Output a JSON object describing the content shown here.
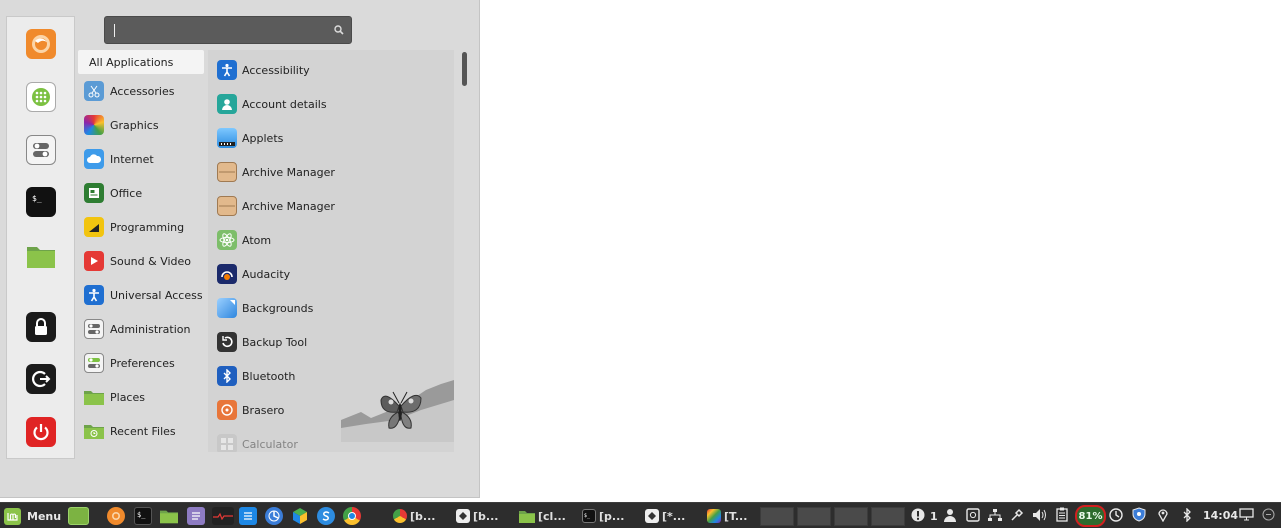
{
  "search": {
    "value": "",
    "placeholder": ""
  },
  "favorites": [
    {
      "name": "firefox-icon"
    },
    {
      "name": "software-manager-icon"
    },
    {
      "name": "settings-toggles-icon"
    },
    {
      "name": "terminal-icon"
    },
    {
      "name": "files-folder-icon"
    },
    {
      "name": "lock-screen-icon"
    },
    {
      "name": "logout-icon"
    },
    {
      "name": "power-icon"
    }
  ],
  "categories": [
    {
      "label": "All Applications"
    },
    {
      "label": "Accessories"
    },
    {
      "label": "Graphics"
    },
    {
      "label": "Internet"
    },
    {
      "label": "Office"
    },
    {
      "label": "Programming"
    },
    {
      "label": "Sound & Video"
    },
    {
      "label": "Universal Access"
    },
    {
      "label": "Administration"
    },
    {
      "label": "Preferences"
    },
    {
      "label": "Places"
    },
    {
      "label": "Recent Files"
    }
  ],
  "apps": [
    {
      "label": "Accessibility"
    },
    {
      "label": "Account details"
    },
    {
      "label": "Applets"
    },
    {
      "label": "Archive Manager"
    },
    {
      "label": "Archive Manager"
    },
    {
      "label": "Atom"
    },
    {
      "label": "Audacity"
    },
    {
      "label": "Backgrounds"
    },
    {
      "label": "Backup Tool"
    },
    {
      "label": "Bluetooth"
    },
    {
      "label": "Brasero"
    },
    {
      "label": "Calculator"
    }
  ],
  "taskbar": {
    "menu_label": "Menu",
    "windows": [
      {
        "label": "[b..."
      },
      {
        "label": "[b..."
      },
      {
        "label": "[cl..."
      },
      {
        "label": "[p..."
      },
      {
        "label": "[*..."
      },
      {
        "label": "[T..."
      }
    ],
    "notification_count": "1",
    "battery_percent": "81%",
    "clock": "14:04"
  },
  "colors": {
    "taskbar_bg": "#2d2d2d",
    "battery_bg": "#2e6b2e",
    "battery_border": "#d21f1f",
    "mint_green": "#8bc34a"
  }
}
